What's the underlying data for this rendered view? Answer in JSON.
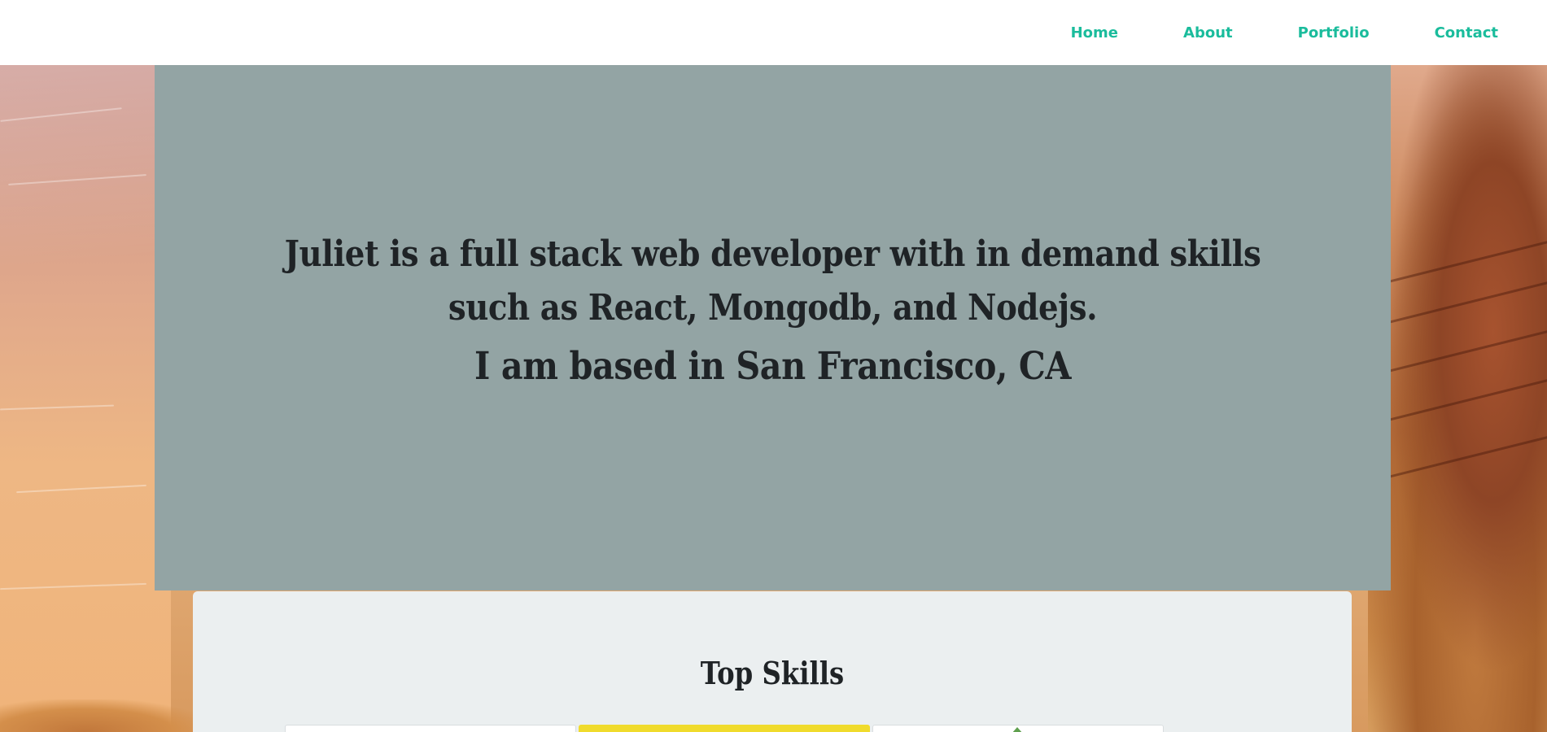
{
  "nav": {
    "links": [
      {
        "label": "Home"
      },
      {
        "label": "About"
      },
      {
        "label": "Portfolio"
      },
      {
        "label": "Contact"
      }
    ],
    "link_color": "#1abc9c"
  },
  "hero": {
    "intro": "Juliet is a full stack web developer with in demand skills such as React, Mongodb, and Nodejs.",
    "location": "I am based in San Francisco, CA",
    "background_color": "#93a4a4"
  },
  "skills": {
    "title": "Top Skills",
    "cards": [
      {
        "icon": "skill-card-icon"
      },
      {
        "icon": "javascript-icon",
        "color": "#f0db2c"
      },
      {
        "icon": "nodejs-leaf-icon",
        "color": "#5fa04e"
      }
    ]
  }
}
